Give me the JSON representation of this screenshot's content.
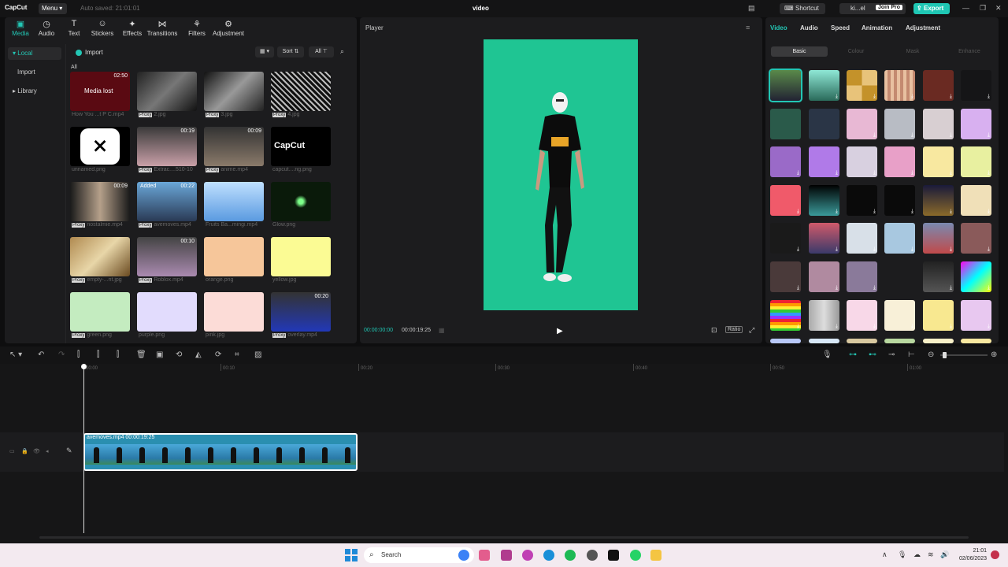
{
  "app": {
    "logo": "CapCut",
    "menu_label": "Menu",
    "autosave": "Auto saved: 21:01:01",
    "project_title": "video",
    "shortcut_label": "Shortcut",
    "user_label": "ki...el",
    "join_pro_label": "Join Pro",
    "export_label": "Export"
  },
  "media_tabs": [
    {
      "label": "Media",
      "icon": "media-icon"
    },
    {
      "label": "Audio",
      "icon": "audio-icon"
    },
    {
      "label": "Text",
      "icon": "text-icon"
    },
    {
      "label": "Stickers",
      "icon": "stickers-icon"
    },
    {
      "label": "Effects",
      "icon": "effects-icon"
    },
    {
      "label": "Transitions",
      "icon": "transitions-icon"
    },
    {
      "label": "Filters",
      "icon": "filters-icon"
    },
    {
      "label": "Adjustment",
      "icon": "adjustment-icon"
    }
  ],
  "left_nav": [
    {
      "label": "Local"
    },
    {
      "label": "Import"
    },
    {
      "label": "Library"
    }
  ],
  "media_toolbar": {
    "import_label": "Import",
    "sort_label": "Sort",
    "all_label": "All",
    "section_label": "All"
  },
  "media_items": [
    {
      "name": "How You ...t P C.mp4",
      "duration": "02:50",
      "overlay": "Media lost",
      "proxy": false
    },
    {
      "name": "2.jpg",
      "duration": "",
      "overlay": "",
      "proxy": true
    },
    {
      "name": "3.jpg",
      "duration": "",
      "overlay": "",
      "proxy": true
    },
    {
      "name": "4.jpg",
      "duration": "",
      "overlay": "",
      "proxy": true
    },
    {
      "name": "unnamed.png",
      "duration": "",
      "overlay": "",
      "proxy": false
    },
    {
      "name": "Extrac....510-10",
      "duration": "00:19",
      "overlay": "",
      "proxy": true
    },
    {
      "name": "anime.mp4",
      "duration": "00:09",
      "overlay": "",
      "proxy": true
    },
    {
      "name": "capcut....ng.png",
      "duration": "",
      "overlay": "",
      "proxy": false
    },
    {
      "name": "nostalmie.mp4",
      "duration": "00:09",
      "overlay": "",
      "proxy": true
    },
    {
      "name": "avemoves.mp4",
      "duration": "00:22",
      "overlay": "Added",
      "proxy": true
    },
    {
      "name": "Fruits Ba...mingi.mp4",
      "duration": "",
      "overlay": "",
      "proxy": false
    },
    {
      "name": "Glow.png",
      "duration": "",
      "overlay": "",
      "proxy": false
    },
    {
      "name": "empty-...nt.jpg",
      "duration": "",
      "overlay": "",
      "proxy": true
    },
    {
      "name": "Roblox.mp4",
      "duration": "00:10",
      "overlay": "",
      "proxy": true
    },
    {
      "name": "orange.png",
      "duration": "",
      "overlay": "",
      "proxy": false
    },
    {
      "name": "yellow.jpg",
      "duration": "",
      "overlay": "",
      "proxy": false
    },
    {
      "name": "green.png",
      "duration": "",
      "overlay": "",
      "proxy": true
    },
    {
      "name": "purple.png",
      "duration": "",
      "overlay": "",
      "proxy": false
    },
    {
      "name": "pink.jpg",
      "duration": "",
      "overlay": "",
      "proxy": false
    },
    {
      "name": "overlay.mp4",
      "duration": "00:20",
      "overlay": "",
      "proxy": true
    }
  ],
  "capcut_logo_text": "CapCut",
  "player": {
    "title": "Player",
    "current_time": "00:00:00:00",
    "total_time": "00:00:19:25",
    "ratio_label": "Ratio",
    "canvas_color": "#1fc593"
  },
  "right_tabs": [
    "Video",
    "Audio",
    "Speed",
    "Animation",
    "Adjustment"
  ],
  "right_subtabs": [
    "Basic",
    "Colour",
    "Mask",
    "Enhance"
  ],
  "timeline": {
    "ruler": [
      "00:00",
      "00:10",
      "00:20",
      "00:30",
      "00:40",
      "00:50",
      "01:00"
    ],
    "clip_label": "avemoves.mp4  00:00:19:25"
  },
  "taskbar": {
    "search_placeholder": "Search",
    "time": "21:01",
    "date": "02/06/2023"
  },
  "colors": {
    "accent": "#23c6b4",
    "export": "#1fc7b4",
    "clip": "#2a8fb0"
  }
}
